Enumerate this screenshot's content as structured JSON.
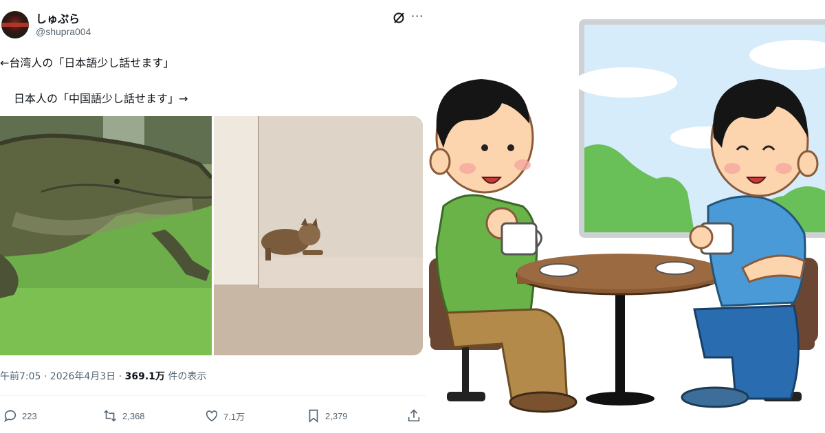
{
  "tweet": {
    "author_name": "しゅぷら",
    "author_handle": "@shupra004",
    "text_line1": "←台湾人の「日本語少し話せます」",
    "text_line2": "日本人の「中国語少し話せます」→",
    "timestamp": "午前7:05 · 2026年4月3日 · ",
    "views_count": "369.1万",
    "views_suffix": " 件の表示",
    "metrics": {
      "replies": "223",
      "reposts": "2,368",
      "likes": "7.1万",
      "bookmarks": "2,379"
    }
  },
  "icons": [
    "grok-icon",
    "more-icon",
    "reply-icon",
    "repost-icon",
    "like-icon",
    "bookmark-icon",
    "share-icon"
  ],
  "colors": {
    "secondary_text": "#536471",
    "primary_text": "#0f1419"
  }
}
